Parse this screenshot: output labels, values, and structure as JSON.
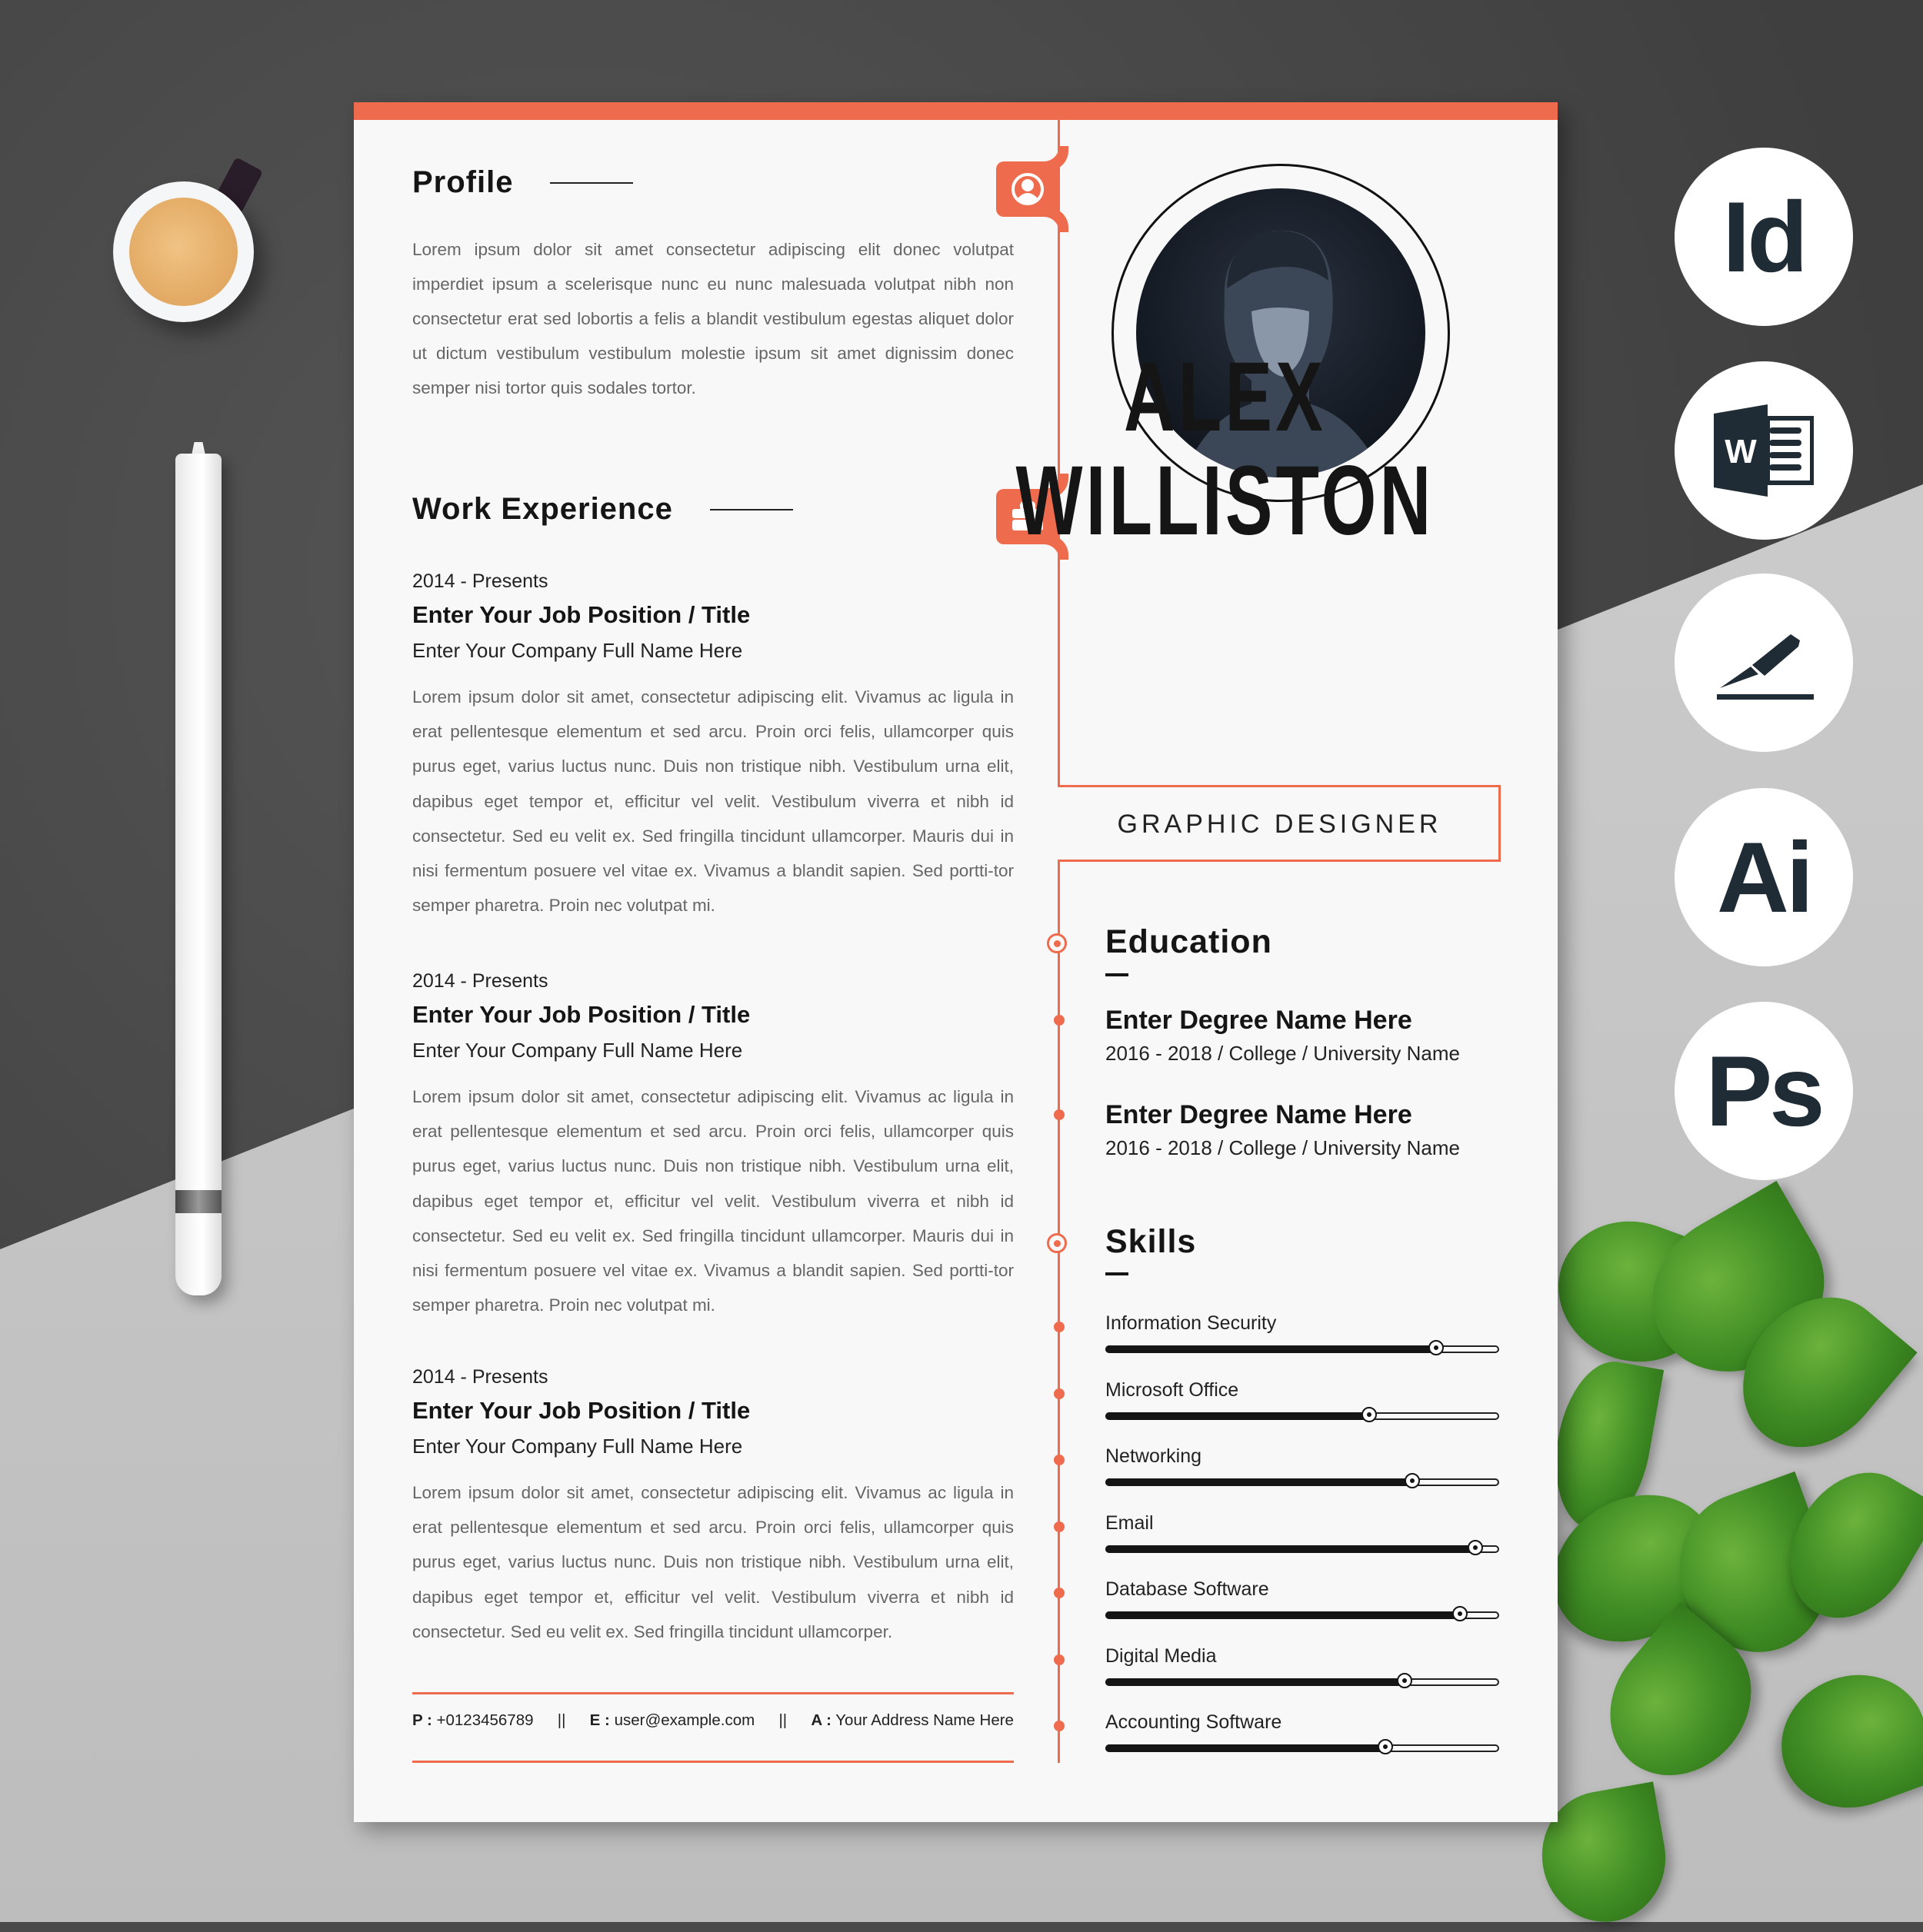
{
  "colors": {
    "accent": "#ee6c4d",
    "text_dark": "#151515",
    "text_body": "#666666",
    "icon_dark": "#1f2b35"
  },
  "profile": {
    "heading": "Profile",
    "icon": "user-icon",
    "text": "Lorem ipsum dolor sit amet consectetur adipiscing elit donec volutpat imperdiet ipsum a scelerisque nunc eu nunc malesuada volutpat nibh non consectetur erat sed lobortis a felis a blandit vestibulum egestas aliquet dolor ut dictum vestibulum vestibulum molestie ipsum sit amet dignissim donec semper nisi tortor quis sodales tortor."
  },
  "experience": {
    "heading": "Work Experience",
    "icon": "briefcase-icon",
    "jobs": [
      {
        "date": "2014 - Presents",
        "title": "Enter Your Job Position / Title",
        "company": "Enter Your Company Full Name Here",
        "description": "Lorem ipsum dolor sit amet, consectetur adipiscing elit. Vivamus ac ligula in erat pellentesque elementum et sed arcu. Proin orci felis, ullamcorper quis purus eget, varius luctus nunc. Duis non tristique nibh. Vestibulum urna elit, dapibus eget tempor et, efficitur vel velit. Vestibulum viverra et nibh id consectetur. Sed eu velit ex. Sed fringilla tincidunt ullamcorper. Mauris dui in nisi fermentum posuere vel vitae ex. Vivamus a blandit sapien. Sed portti-tor semper pharetra. Proin nec volutpat mi."
      },
      {
        "date": "2014 - Presents",
        "title": "Enter Your Job Position / Title",
        "company": "Enter Your Company Full Name Here",
        "description": "Lorem ipsum dolor sit amet, consectetur adipiscing elit. Vivamus ac ligula in erat pellentesque elementum et sed arcu. Proin orci felis, ullamcorper quis purus eget, varius luctus nunc. Duis non tristique nibh. Vestibulum urna elit, dapibus eget tempor et, efficitur vel velit. Vestibulum viverra et nibh id consectetur. Sed eu velit ex. Sed fringilla tincidunt ullamcorper. Mauris dui in nisi fermentum posuere vel vitae ex. Vivamus a blandit sapien. Sed portti-tor semper pharetra. Proin nec volutpat mi."
      },
      {
        "date": "2014 - Presents",
        "title": "Enter Your Job Position / Title",
        "company": "Enter Your Company Full Name Here",
        "description": "Lorem ipsum dolor sit amet, consectetur adipiscing elit. Vivamus ac ligula in erat pellentesque elementum et sed arcu. Proin orci felis, ullamcorper quis purus eget, varius luctus nunc. Duis non tristique nibh. Vestibulum urna elit, dapibus eget tempor et, efficitur vel velit. Vestibulum viverra et nibh id consectetur. Sed eu velit ex. Sed fringilla tincidunt ullamcorper."
      }
    ]
  },
  "contact": {
    "phone_label": "P :",
    "phone": "+0123456789",
    "separator": "||",
    "email_label": "E :",
    "email": "user@example.com",
    "address_label": "A :",
    "address": "Your Address Name Here"
  },
  "header": {
    "first_name": "ALEX",
    "last_name": "WILLISTON",
    "job_title": "GRAPHIC DESIGNER",
    "photo": "portrait-photo"
  },
  "education": {
    "heading": "Education",
    "items": [
      {
        "degree": "Enter Degree Name Here",
        "info": "2016 - 2018 / College / University Name"
      },
      {
        "degree": "Enter Degree Name Here",
        "info": "2016 - 2018 / College / University Name"
      }
    ]
  },
  "skills": {
    "heading": "Skills",
    "items": [
      {
        "name": "Information Security",
        "level": 0.84
      },
      {
        "name": "Microsoft Office",
        "level": 0.67
      },
      {
        "name": "Networking",
        "level": 0.78
      },
      {
        "name": "Email",
        "level": 0.94
      },
      {
        "name": "Database Software",
        "level": 0.9
      },
      {
        "name": "Digital Media",
        "level": 0.76
      },
      {
        "name": "Accounting Software",
        "level": 0.71
      }
    ]
  },
  "app_badges": [
    {
      "icon": "indesign-icon",
      "label": "Id"
    },
    {
      "icon": "word-icon",
      "label": "W"
    },
    {
      "icon": "pen-tool-icon",
      "label": ""
    },
    {
      "icon": "illustrator-icon",
      "label": "Ai"
    },
    {
      "icon": "photoshop-icon",
      "label": "Ps"
    }
  ]
}
